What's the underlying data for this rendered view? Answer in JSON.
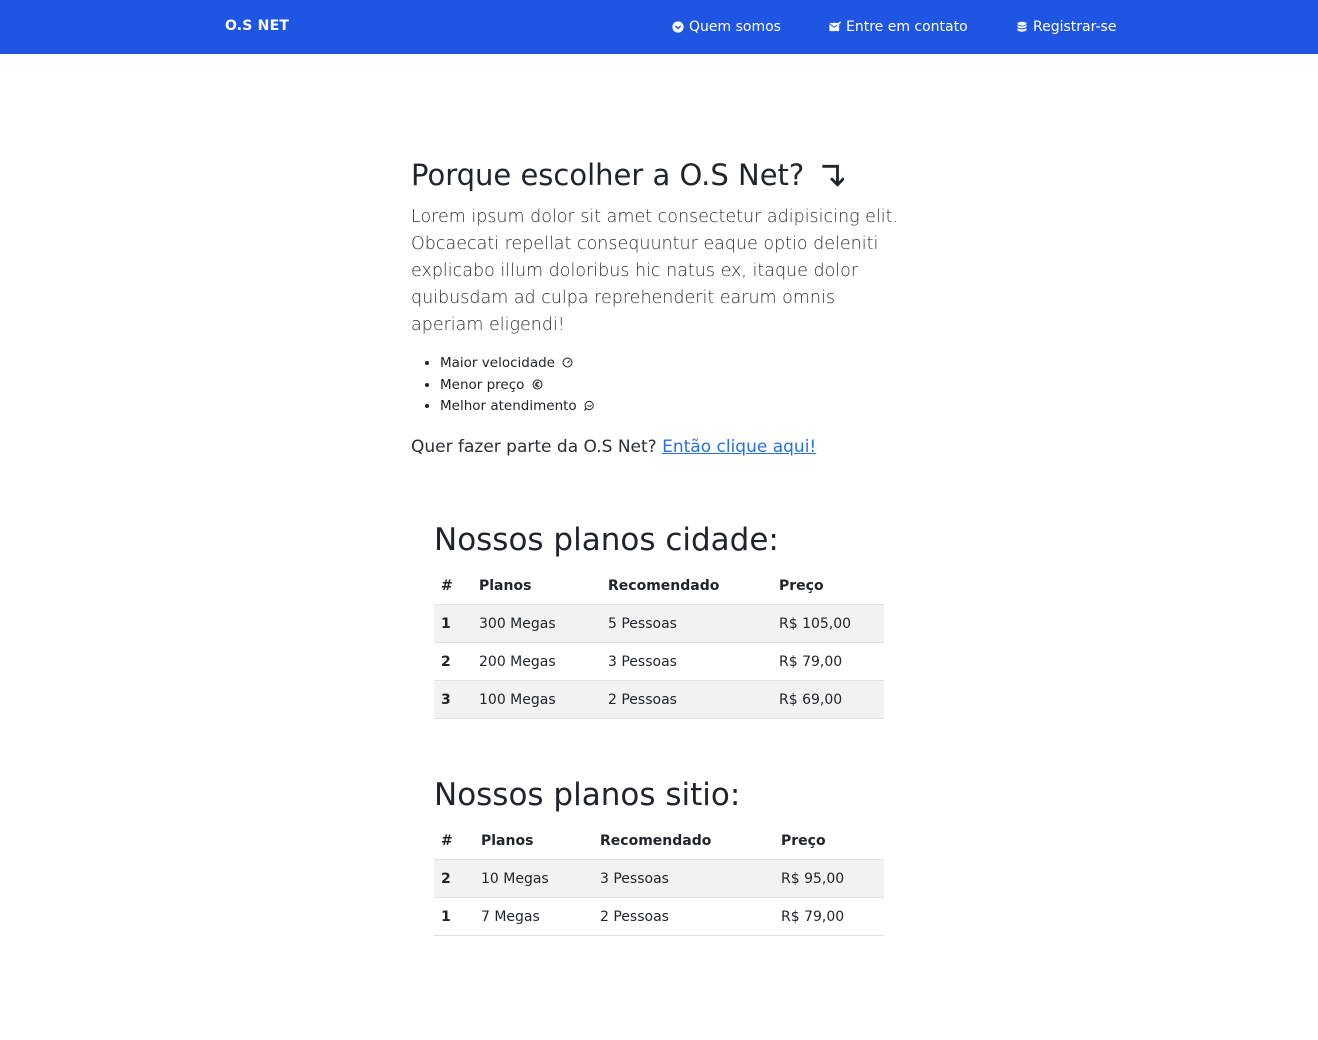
{
  "colors": {
    "navbar": "#1e56e3",
    "link": "#2a6fdb"
  },
  "navbar": {
    "brand": "O.S NET",
    "links": [
      {
        "label": "Quem somos",
        "icon": "chevron-down-circle-icon"
      },
      {
        "label": "Entre em contato",
        "icon": "envelope-check-icon"
      },
      {
        "label": "Registrar-se",
        "icon": "database-icon"
      }
    ]
  },
  "intro": {
    "title": "Porque escolher a O.S Net?",
    "title_icon": "arrow-down-right-icon",
    "text": "Lorem ipsum dolor sit amet consectetur adipisicing elit. Obcaecati repellat consequuntur eaque optio deleniti explicabo illum doloribus hic natus ex, itaque dolor quibusdam ad culpa reprehenderit earum omnis aperiam eligendi!",
    "features": [
      {
        "label": "Maior velocidade",
        "icon": "speedometer-icon"
      },
      {
        "label": "Menor preço",
        "icon": "currency-icon"
      },
      {
        "label": "Melhor atendimento",
        "icon": "chat-icon"
      }
    ],
    "cta_text": "Quer fazer parte da O.S Net?",
    "cta_link": "Então clique aqui!"
  },
  "plans_cidade": {
    "title": "Nossos planos cidade:",
    "headers": [
      "#",
      "Planos",
      "Recomendado",
      "Preço"
    ],
    "rows": [
      [
        "1",
        "300 Megas",
        "5 Pessoas",
        "R$ 105,00"
      ],
      [
        "2",
        "200 Megas",
        "3 Pessoas",
        "R$ 79,00"
      ],
      [
        "3",
        "100 Megas",
        "2 Pessoas",
        "R$ 69,00"
      ]
    ]
  },
  "plans_sitio": {
    "title": "Nossos planos sitio:",
    "headers": [
      "#",
      "Planos",
      "Recomendado",
      "Preço"
    ],
    "rows": [
      [
        "2",
        "10 Megas",
        "3 Pessoas",
        "R$ 95,00"
      ],
      [
        "1",
        "7 Megas",
        "2 Pessoas",
        "R$ 79,00"
      ]
    ]
  }
}
